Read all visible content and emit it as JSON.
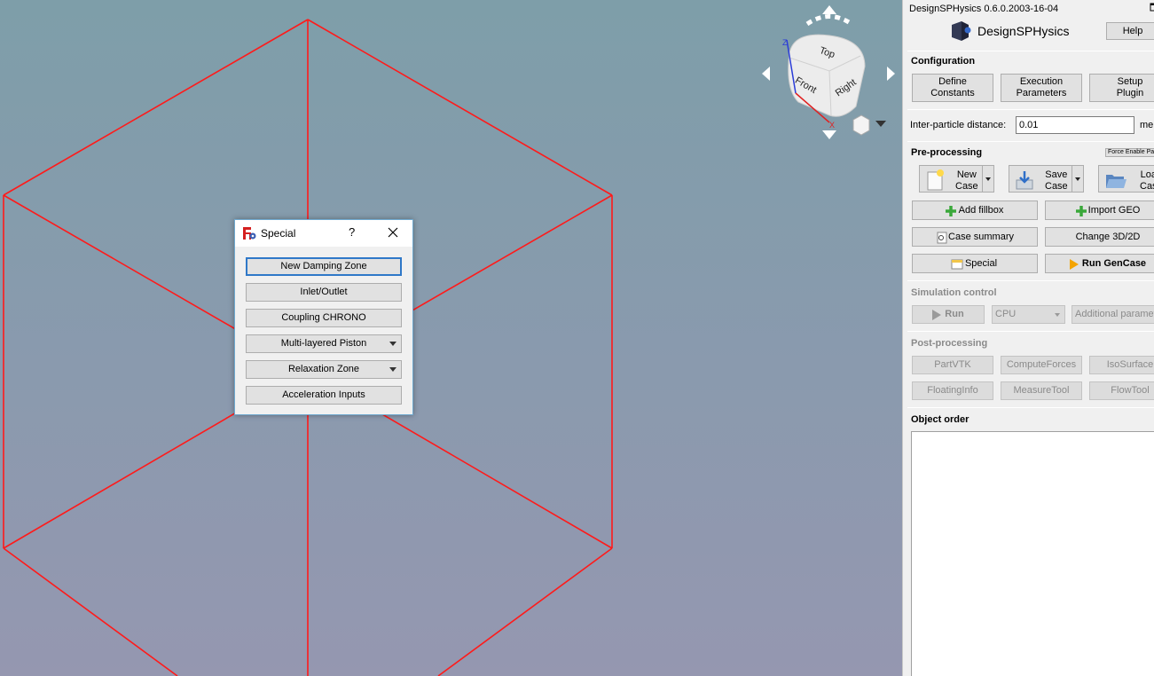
{
  "viewport": {
    "navcube": {
      "top_label": "Top",
      "front_label": "Front",
      "right_label": "Right",
      "axis_z": "Z",
      "axis_x": "X"
    }
  },
  "dialog": {
    "title": "Special",
    "help_label": "?",
    "buttons": [
      {
        "label": "New Damping Zone"
      },
      {
        "label": "Inlet/Outlet"
      },
      {
        "label": "Coupling CHRONO"
      },
      {
        "label": "Multi-layered Piston"
      },
      {
        "label": "Relaxation Zone"
      },
      {
        "label": "Acceleration Inputs"
      }
    ]
  },
  "panel": {
    "title": "DesignSPHysics 0.6.0.2003-16-04",
    "logo_text": "DesignSPHysics",
    "help_button": "Help",
    "configuration": {
      "heading": "Configuration",
      "define_constants": [
        "Define",
        "Constants"
      ],
      "execution_parameters": [
        "Execution",
        "Parameters"
      ],
      "setup_plugin": [
        "Setup",
        "Plugin"
      ],
      "dp_label": "Inter-particle distance:",
      "dp_value": "0.01",
      "dp_unit": "me"
    },
    "preprocessing": {
      "heading": "Pre-processing",
      "force_enable": "Force Enable Pa",
      "new_case": [
        "New",
        "Case"
      ],
      "save_case": [
        "Save",
        "Case"
      ],
      "load_case": [
        "Load",
        "Case"
      ],
      "add_fillbox": "Add fillbox",
      "import_geo": "Import GEO",
      "case_summary": "Case summary",
      "change_3d2d": "Change 3D/2D",
      "special": "Special",
      "run_gencase": "Run GenCase"
    },
    "simulation": {
      "heading": "Simulation control",
      "run": "Run",
      "device": "CPU",
      "additional": "Additional paramet"
    },
    "postprocessing": {
      "heading": "Post-processing",
      "partvtk": "PartVTK",
      "computeforces": "ComputeForces",
      "isosurface": "IsoSurface",
      "floatinginfo": "FloatingInfo",
      "measuretool": "MeasureTool",
      "flowtool": "FlowTool"
    },
    "object_order": {
      "heading": "Object order"
    }
  },
  "colors": {
    "wireframe": "#ff1a1a",
    "accent": "#2f78c8",
    "run_arrow": "#f4a400",
    "plus_green": "#3aa83a"
  }
}
